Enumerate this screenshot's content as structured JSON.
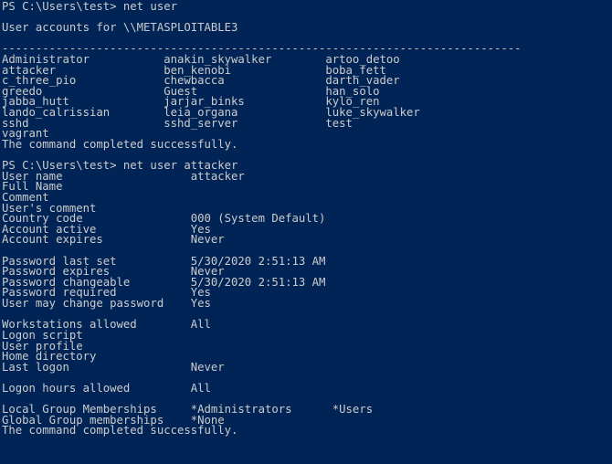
{
  "terminal": {
    "shell": "PowerShell",
    "background_color": "#012456",
    "foreground_color": "#cccccc",
    "columns": 93,
    "rows": 44
  },
  "prompt": {
    "path": "PS C:\\Users\\test>"
  },
  "commands": [
    {
      "name": "net-user-list",
      "command_line": "PS C:\\Users\\test> net user"
    },
    {
      "name": "net-user-attacker",
      "command_line": "PS C:\\Users\\test> net user attacker"
    }
  ],
  "user_list": {
    "header": "User accounts for \\\\METASPLOITABLE3",
    "separator": "-----------------------------------------------------------------------------",
    "rows": [
      [
        "Administrator",
        "anakin_skywalker",
        "artoo_detoo"
      ],
      [
        "attacker",
        "ben_kenobi",
        "boba_fett"
      ],
      [
        "c_three_pio",
        "chewbacca",
        "darth_vader"
      ],
      [
        "greedo",
        "Guest",
        "han_solo"
      ],
      [
        "jabba_hutt",
        "jarjar_binks",
        "kylo_ren"
      ],
      [
        "lando_calrissian",
        "leia_organa",
        "luke_skywalker"
      ],
      [
        "sshd",
        "sshd_server",
        "test"
      ],
      [
        "vagrant",
        "",
        ""
      ]
    ],
    "status": "The command completed successfully."
  },
  "user_detail": {
    "fields": [
      {
        "label": "User name",
        "value": "attacker"
      },
      {
        "label": "Full Name",
        "value": ""
      },
      {
        "label": "Comment",
        "value": ""
      },
      {
        "label": "User's comment",
        "value": ""
      },
      {
        "label": "Country code",
        "value": "000 (System Default)"
      },
      {
        "label": "Account active",
        "value": "Yes"
      },
      {
        "label": "Account expires",
        "value": "Never"
      },
      {
        "label": "",
        "value": ""
      },
      {
        "label": "Password last set",
        "value": "5/30/2020 2:51:13 AM"
      },
      {
        "label": "Password expires",
        "value": "Never"
      },
      {
        "label": "Password changeable",
        "value": "5/30/2020 2:51:13 AM"
      },
      {
        "label": "Password required",
        "value": "Yes"
      },
      {
        "label": "User may change password",
        "value": "Yes"
      },
      {
        "label": "",
        "value": ""
      },
      {
        "label": "Workstations allowed",
        "value": "All"
      },
      {
        "label": "Logon script",
        "value": ""
      },
      {
        "label": "User profile",
        "value": ""
      },
      {
        "label": "Home directory",
        "value": ""
      },
      {
        "label": "Last logon",
        "value": "Never"
      },
      {
        "label": "",
        "value": ""
      },
      {
        "label": "Logon hours allowed",
        "value": "All"
      },
      {
        "label": "",
        "value": ""
      },
      {
        "label": "Local Group Memberships",
        "value": "*Administrators",
        "value2": "*Users"
      },
      {
        "label": "Global Group memberships",
        "value": "*None"
      }
    ],
    "status": "The command completed successfully."
  }
}
